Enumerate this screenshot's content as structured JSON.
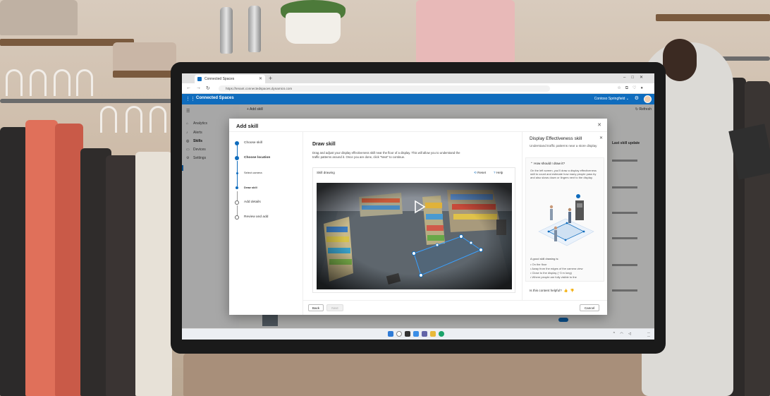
{
  "browser": {
    "tab_title": "Connected Spaces",
    "new_tab": "+",
    "url": "https://tenant.connectedspaces.dynamics.com"
  },
  "app": {
    "name": "Connected Spaces",
    "org": "Contoso Springfield",
    "brand_color": "#0f6cbd"
  },
  "nav": {
    "items": [
      {
        "label": "Analytics",
        "icon": "chart-icon"
      },
      {
        "label": "Alerts",
        "icon": "bell-icon"
      },
      {
        "label": "Skills",
        "icon": "skill-icon"
      },
      {
        "label": "Devices",
        "icon": "device-icon"
      },
      {
        "label": "Settings",
        "icon": "gear-icon"
      }
    ],
    "active": "Skills"
  },
  "page": {
    "add_skill": "Add skill",
    "refresh": "Refresh",
    "column_header": "Last skill update"
  },
  "dialog": {
    "title": "Add skill",
    "steps": [
      {
        "label": "Choose skill",
        "state": "done"
      },
      {
        "label": "Choose location",
        "state": "done"
      },
      {
        "label": "Select camera",
        "state": "sub"
      },
      {
        "label": "Draw skill",
        "state": "current"
      },
      {
        "label": "Add details",
        "state": "todo"
      },
      {
        "label": "Review and add",
        "state": "todo"
      }
    ],
    "content": {
      "title": "Draw skill",
      "description": "Drag and adjust your display effectiveness skill near the floor of a display. This will allow you to understand the traffic patterns around it. Once you are done, click \"Next\" to continue.",
      "drawing_label": "Skill drawing",
      "reset": "Reset",
      "help": "Help"
    },
    "footer": {
      "back": "Back",
      "next": "Next",
      "cancel": "Cancel"
    }
  },
  "help_pane": {
    "title": "Display Effectiveness skill",
    "subtitle": "Understand traffic patterns near a store display",
    "question": "How should I draw it?",
    "paragraph": "On the left screen, you'll draw a display effectiveness skill to count and estimate how many people pass by and also slows down or lingers next to the display.",
    "good_heading": "A good skill drawing is:",
    "good_list": [
      "On the floor",
      "Away from the edges of the camera view",
      "Close to the display (~3 m long)",
      "Where people are fully visible to the"
    ],
    "helpful_question": "Is this content helpful?"
  }
}
